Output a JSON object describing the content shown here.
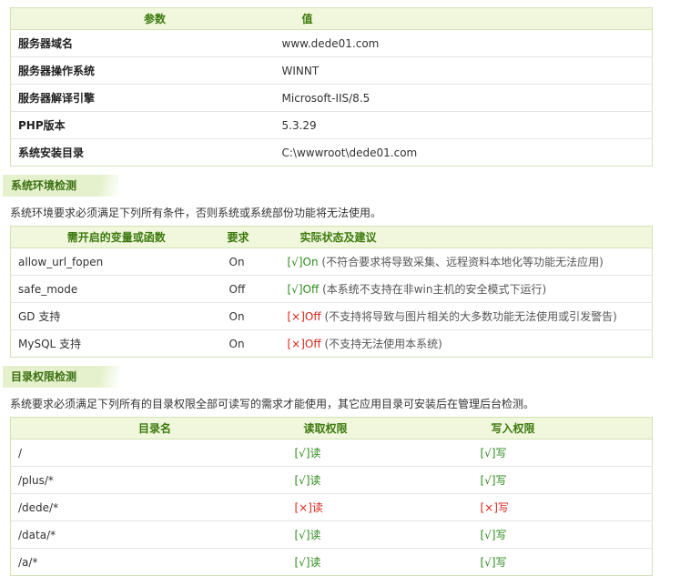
{
  "server": {
    "headers": [
      "参数",
      "值"
    ],
    "rows": [
      {
        "key": "服务器域名",
        "value": "www.dede01.com"
      },
      {
        "key": "服务器操作系统",
        "value": "WINNT"
      },
      {
        "key": "服务器解译引擎",
        "value": "Microsoft-IIS/8.5"
      },
      {
        "key": "PHP版本",
        "value": "5.3.29"
      },
      {
        "key": "系统安装目录",
        "value": "C:\\wwwroot\\dede01.com"
      }
    ]
  },
  "env": {
    "title": "系统环境检测",
    "desc": "系统环境要求必须满足下列所有条件，否则系统或系统部份功能将无法使用。",
    "headers": [
      "需开启的变量或函数",
      "要求",
      "实际状态及建议"
    ],
    "rows": [
      {
        "name": "allow_url_fopen",
        "req": "On",
        "mark": "[√]",
        "state": "On",
        "note": "(不符合要求将导致采集、远程资料本地化等功能无法应用)",
        "ok": true
      },
      {
        "name": "safe_mode",
        "req": "Off",
        "mark": "[√]",
        "state": "Off",
        "note": "(本系统不支持在非win主机的安全模式下运行)",
        "ok": true
      },
      {
        "name": "GD 支持",
        "req": "On",
        "mark": "[×]",
        "state": "Off",
        "note": "(不支持将导致与图片相关的大多数功能无法使用或引发警告)",
        "ok": false
      },
      {
        "name": "MySQL 支持",
        "req": "On",
        "mark": "[×]",
        "state": "Off",
        "note": "(不支持无法使用本系统)",
        "ok": false
      }
    ]
  },
  "perm": {
    "title": "目录权限检测",
    "desc": "系统要求必须满足下列所有的目录权限全部可读写的需求才能使用，其它应用目录可安装后在管理后台检测。",
    "headers": [
      "目录名",
      "读取权限",
      "写入权限"
    ],
    "rows": [
      {
        "dir": "/",
        "read_mark": "[√]",
        "read": "读",
        "read_ok": true,
        "write_mark": "[√]",
        "write": "写",
        "write_ok": true
      },
      {
        "dir": "/plus/*",
        "read_mark": "[√]",
        "read": "读",
        "read_ok": true,
        "write_mark": "[√]",
        "write": "写",
        "write_ok": true
      },
      {
        "dir": "/dede/*",
        "read_mark": "[×]",
        "read": "读",
        "read_ok": false,
        "write_mark": "[×]",
        "write": "写",
        "write_ok": false
      },
      {
        "dir": "/data/*",
        "read_mark": "[√]",
        "read": "读",
        "read_ok": true,
        "write_mark": "[√]",
        "write": "写",
        "write_ok": true
      },
      {
        "dir": "/a/*",
        "read_mark": "[√]",
        "read": "读",
        "read_ok": true,
        "write_mark": "[√]",
        "write": "写",
        "write_ok": true
      }
    ]
  }
}
